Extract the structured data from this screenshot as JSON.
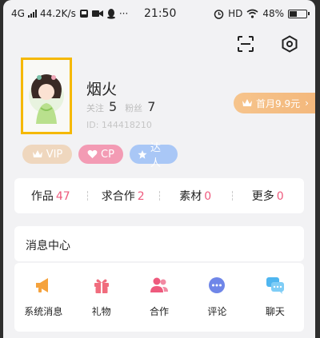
{
  "status_bar": {
    "network": "4G",
    "speed": "44.2K/s",
    "time": "21:50",
    "hd": "HD",
    "battery": "48%",
    "battery_level": 0.48,
    "more": "···"
  },
  "header": {
    "scan_icon": "scan-icon",
    "settings_icon": "settings-hexagon-icon"
  },
  "profile": {
    "username": "烟火",
    "following_label": "关注",
    "following_count": "5",
    "fans_label": "粉丝",
    "fans_count": "7",
    "user_id": "ID: 144418210",
    "vip_offer": "首月9.9元",
    "frame_color": "#f5b800"
  },
  "badges": [
    {
      "label": "VIP",
      "icon": "crown-icon",
      "color": "#efd7be"
    },
    {
      "label": "CP",
      "icon": "heart-icon",
      "color": "#f39bb4"
    },
    {
      "label": "达人",
      "icon": "star-icon",
      "color": "#a9c7f6"
    }
  ],
  "tabs": [
    {
      "label": "作品",
      "count": "47"
    },
    {
      "label": "求合作",
      "count": "2"
    },
    {
      "label": "素材",
      "count": "0"
    },
    {
      "label": "更多",
      "count": "0"
    }
  ],
  "message_center": {
    "title": "消息中心",
    "items": [
      {
        "label": "系统消息",
        "icon": "megaphone-icon",
        "color": "#f5a23c"
      },
      {
        "label": "礼物",
        "icon": "gift-icon",
        "color": "#f06c7d"
      },
      {
        "label": "合作",
        "icon": "people-icon",
        "color": "#ee5a7d"
      },
      {
        "label": "评论",
        "icon": "comment-icon",
        "color": "#6f86e8"
      },
      {
        "label": "聊天",
        "icon": "chat-icon",
        "color": "#4fb6f0"
      }
    ]
  },
  "colors": {
    "accent_pink": "#ee5a7d",
    "background": "#f2f2f4"
  }
}
